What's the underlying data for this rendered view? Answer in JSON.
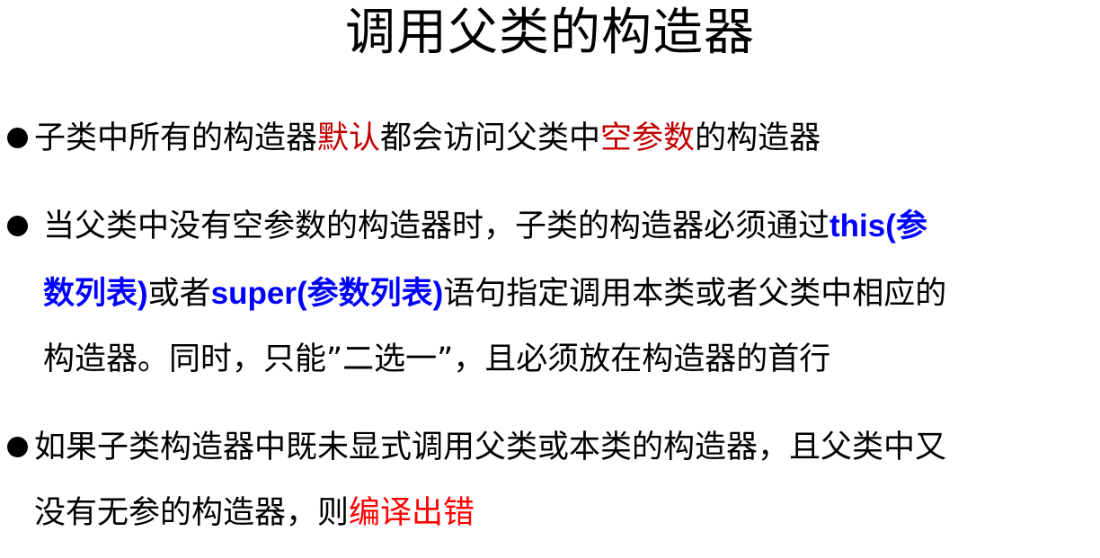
{
  "title": "调用父类的构造器",
  "bullet1": {
    "part1": "子类中所有的构造器",
    "hl1": "默认",
    "part2": "都会访问父类中",
    "hl2": "空参数",
    "part3": "的构造器"
  },
  "bullet2": {
    "line1_text": "当父类中没有空参数的构造器时，子类的构造器必须通过",
    "line1_code": "this(参",
    "line2_code1": "数列表)",
    "line2_text1": "或者",
    "line2_code2": "super(参数列表)",
    "line2_text2": "语句指定调用本类或者父类中相应的",
    "line3_text": "构造器。同时，只能”二选一”，且必须放在构造器的首行"
  },
  "bullet3": {
    "line1_text": "如果子类构造器中既未显式调用父类或本类的构造器，且父类中又",
    "line2_text": "没有无参的构造器，则",
    "line2_hl": "编译出错"
  },
  "colors": {
    "highlight_dark_red": "#c00000",
    "highlight_red": "#ff0000",
    "code_blue": "#0000ff"
  }
}
